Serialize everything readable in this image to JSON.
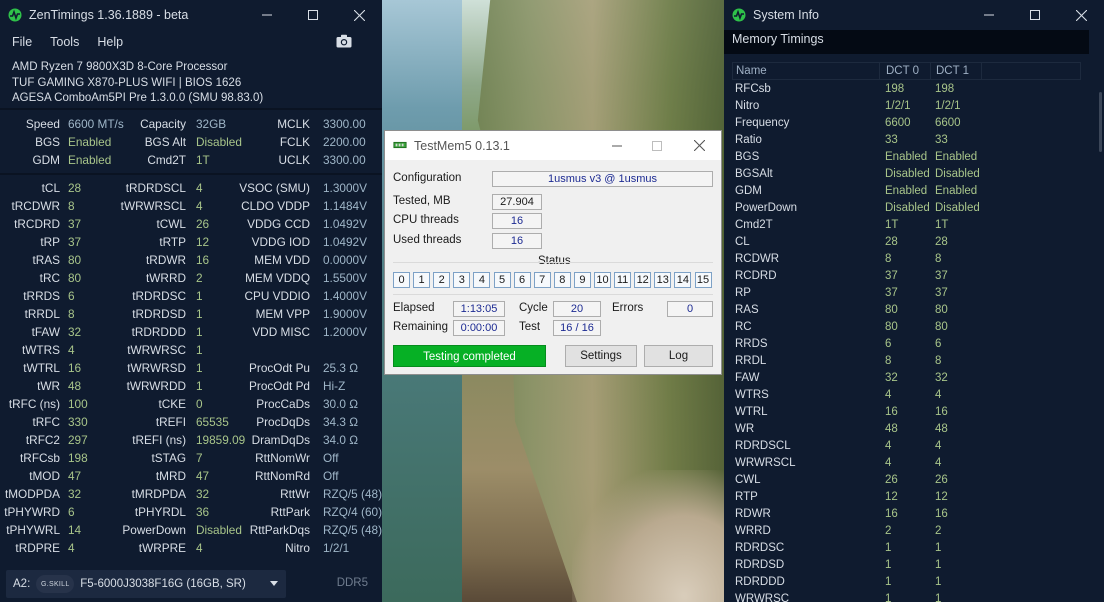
{
  "zen": {
    "title": "ZenTimings 1.36.1889 - beta",
    "menu": [
      "File",
      "Tools",
      "Help"
    ],
    "cpu": "AMD Ryzen 7 9800X3D 8-Core Processor",
    "board": "TUF GAMING X870-PLUS WIFI | BIOS 1626",
    "agesa": "AGESA ComboAm5PI Pre 1.3.0.0 (SMU 98.83.0)",
    "rows": [
      [
        [
          "Speed",
          "6600 MT/s",
          "b"
        ],
        [
          "Capacity",
          "32GB",
          "b"
        ],
        [
          "MCLK",
          "3300.00",
          "b"
        ]
      ],
      [
        [
          "BGS",
          "Enabled",
          "g"
        ],
        [
          "BGS Alt",
          "Disabled",
          "g"
        ],
        [
          "FCLK",
          "2200.00",
          "b"
        ]
      ],
      [
        [
          "GDM",
          "Enabled",
          "g"
        ],
        [
          "Cmd2T",
          "1T",
          "g"
        ],
        [
          "UCLK",
          "3300.00",
          "b"
        ]
      ],
      [
        [
          "tCL",
          "28",
          "g"
        ],
        [
          "tRDRDSCL",
          "4",
          "g"
        ],
        [
          "VSOC (SMU)",
          "1.3000V",
          "b"
        ]
      ],
      [
        [
          "tRCDWR",
          "8",
          "g"
        ],
        [
          "tWRWRSCL",
          "4",
          "g"
        ],
        [
          "CLDO VDDP",
          "1.1484V",
          "b"
        ]
      ],
      [
        [
          "tRCDRD",
          "37",
          "g"
        ],
        [
          "tCWL",
          "26",
          "g"
        ],
        [
          "VDDG CCD",
          "1.0492V",
          "b"
        ]
      ],
      [
        [
          "tRP",
          "37",
          "g"
        ],
        [
          "tRTP",
          "12",
          "g"
        ],
        [
          "VDDG IOD",
          "1.0492V",
          "b"
        ]
      ],
      [
        [
          "tRAS",
          "80",
          "g"
        ],
        [
          "tRDWR",
          "16",
          "g"
        ],
        [
          "MEM VDD",
          "0.0000V",
          "b"
        ]
      ],
      [
        [
          "tRC",
          "80",
          "g"
        ],
        [
          "tWRRD",
          "2",
          "g"
        ],
        [
          "MEM VDDQ",
          "1.5500V",
          "b"
        ]
      ],
      [
        [
          "tRRDS",
          "6",
          "g"
        ],
        [
          "tRDRDSC",
          "1",
          "g"
        ],
        [
          "CPU VDDIO",
          "1.4000V",
          "b"
        ]
      ],
      [
        [
          "tRRDL",
          "8",
          "g"
        ],
        [
          "tRDRDSD",
          "1",
          "g"
        ],
        [
          "MEM VPP",
          "1.9000V",
          "b"
        ]
      ],
      [
        [
          "tFAW",
          "32",
          "g"
        ],
        [
          "tRDRDDD",
          "1",
          "g"
        ],
        [
          "VDD MISC",
          "1.2000V",
          "b"
        ]
      ],
      [
        [
          "tWTRS",
          "4",
          "g"
        ],
        [
          "tWRWRSC",
          "1",
          "g"
        ],
        [
          "",
          "",
          " "
        ]
      ],
      [
        [
          "tWTRL",
          "16",
          "g"
        ],
        [
          "tWRWRSD",
          "1",
          "g"
        ],
        [
          "ProcOdt Pu",
          "25.3 Ω",
          "b"
        ]
      ],
      [
        [
          "tWR",
          "48",
          "g"
        ],
        [
          "tWRWRDD",
          "1",
          "g"
        ],
        [
          "ProcOdt Pd",
          "Hi-Z",
          "b"
        ]
      ],
      [
        [
          "tRFC (ns)",
          "100",
          "g"
        ],
        [
          "tCKE",
          "0",
          "g"
        ],
        [
          "ProcCaDs",
          "30.0 Ω",
          "b"
        ]
      ],
      [
        [
          "tRFC",
          "330",
          "g"
        ],
        [
          "tREFI",
          "65535",
          "g"
        ],
        [
          "ProcDqDs",
          "34.3 Ω",
          "b"
        ]
      ],
      [
        [
          "tRFC2",
          "297",
          "g"
        ],
        [
          "tREFI (ns)",
          "19859.09",
          "g"
        ],
        [
          "DramDqDs",
          "34.0 Ω",
          "b"
        ]
      ],
      [
        [
          "tRFCsb",
          "198",
          "g"
        ],
        [
          "tSTAG",
          "7",
          "g"
        ],
        [
          "RttNomWr",
          "Off",
          "b"
        ]
      ],
      [
        [
          "tMOD",
          "47",
          "g"
        ],
        [
          "tMRD",
          "47",
          "g"
        ],
        [
          "RttNomRd",
          "Off",
          "b"
        ]
      ],
      [
        [
          "tMODPDA",
          "32",
          "g"
        ],
        [
          "tMRDPDA",
          "32",
          "g"
        ],
        [
          "RttWr",
          "RZQ/5 (48)",
          "b"
        ]
      ],
      [
        [
          "tPHYWRD",
          "6",
          "g"
        ],
        [
          "tPHYRDL",
          "36",
          "g"
        ],
        [
          "RttPark",
          "RZQ/4 (60)",
          "b"
        ]
      ],
      [
        [
          "tPHYWRL",
          "14",
          "g"
        ],
        [
          "PowerDown",
          "Disabled",
          "g"
        ],
        [
          "RttParkDqs",
          "RZQ/5 (48)",
          "b"
        ]
      ],
      [
        [
          "tRDPRE",
          "4",
          "g"
        ],
        [
          "tWRPRE",
          "4",
          "g"
        ],
        [
          "Nitro",
          "1/2/1",
          "b"
        ]
      ]
    ],
    "dimm_slot": "A2:",
    "dimm_brand": "G.SKILL",
    "dimm_part": "F5-6000J3038F16G (16GB, SR)",
    "ddr": "DDR5"
  },
  "tm5": {
    "title": "TestMem5  0.13.1",
    "config_label": "Configuration",
    "config_value": "1usmus v3 @ 1usmus",
    "tested_label": "Tested, MB",
    "tested_value": "27.904",
    "cpu_threads_label": "CPU threads",
    "cpu_threads_value": "16",
    "used_threads_label": "Used threads",
    "used_threads_value": "16",
    "status_label": "Status",
    "cells": [
      "0",
      "1",
      "2",
      "3",
      "4",
      "5",
      "6",
      "7",
      "8",
      "9",
      "10",
      "11",
      "12",
      "13",
      "14",
      "15"
    ],
    "elapsed_label": "Elapsed",
    "elapsed_value": "1:13:05",
    "cycle_label": "Cycle",
    "cycle_value": "20",
    "errors_label": "Errors",
    "errors_value": "0",
    "remaining_label": "Remaining",
    "remaining_value": "0:00:00",
    "test_label": "Test",
    "test_value": "16 / 16",
    "progress_text": "Testing completed",
    "progress_fraction": 1.0,
    "settings_label": "Settings",
    "log_label": "Log",
    "progress_color": "#06b025"
  },
  "sys": {
    "title": "System Info",
    "heading": "Memory Timings",
    "col_name": "Name",
    "col_dct0": "DCT 0",
    "col_dct1": "DCT 1",
    "rows": [
      [
        "RFCsb",
        "198",
        "198"
      ],
      [
        "Nitro",
        "1/2/1",
        "1/2/1"
      ],
      [
        "Frequency",
        "6600",
        "6600"
      ],
      [
        "Ratio",
        "33",
        "33"
      ],
      [
        "BGS",
        "Enabled",
        "Enabled"
      ],
      [
        "BGSAlt",
        "Disabled",
        "Disabled"
      ],
      [
        "GDM",
        "Enabled",
        "Enabled"
      ],
      [
        "PowerDown",
        "Disabled",
        "Disabled"
      ],
      [
        "Cmd2T",
        "1T",
        "1T"
      ],
      [
        "CL",
        "28",
        "28"
      ],
      [
        "RCDWR",
        "8",
        "8"
      ],
      [
        "RCDRD",
        "37",
        "37"
      ],
      [
        "RP",
        "37",
        "37"
      ],
      [
        "RAS",
        "80",
        "80"
      ],
      [
        "RC",
        "80",
        "80"
      ],
      [
        "RRDS",
        "6",
        "6"
      ],
      [
        "RRDL",
        "8",
        "8"
      ],
      [
        "FAW",
        "32",
        "32"
      ],
      [
        "WTRS",
        "4",
        "4"
      ],
      [
        "WTRL",
        "16",
        "16"
      ],
      [
        "WR",
        "48",
        "48"
      ],
      [
        "RDRDSCL",
        "4",
        "4"
      ],
      [
        "WRWRSCL",
        "4",
        "4"
      ],
      [
        "CWL",
        "26",
        "26"
      ],
      [
        "RTP",
        "12",
        "12"
      ],
      [
        "RDWR",
        "16",
        "16"
      ],
      [
        "WRRD",
        "2",
        "2"
      ],
      [
        "RDRDSC",
        "1",
        "1"
      ],
      [
        "RDRDSD",
        "1",
        "1"
      ],
      [
        "RDRDDD",
        "1",
        "1"
      ],
      [
        "WRWRSC",
        "1",
        "1"
      ]
    ]
  },
  "colors": {
    "value_green": "#a8c58a",
    "value_blue": "#9fb6c8",
    "window_bg": "#0f1b2f",
    "brand_green": "#2fc24a"
  },
  "icons": [
    "zentimings-logo-icon",
    "minimize-icon",
    "maximize-icon",
    "close-icon",
    "camera-icon",
    "chevron-down-icon",
    "testmem-chip-icon"
  ]
}
